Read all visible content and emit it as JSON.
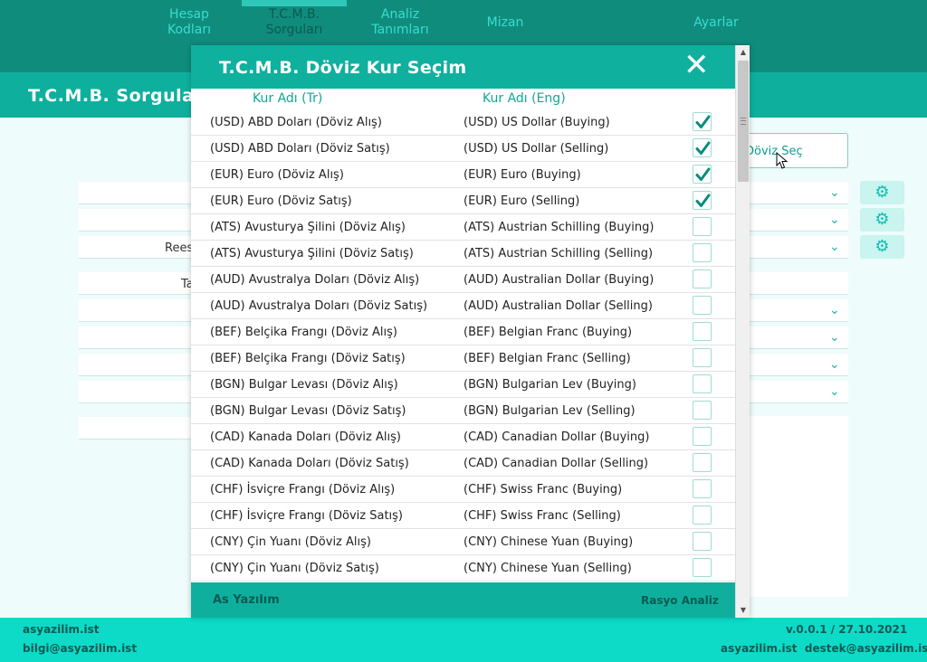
{
  "nav": {
    "items": [
      {
        "label_line1": "Hesap",
        "label_line2": "Kodları"
      },
      {
        "label_line1": "T.C.M.B.",
        "label_line2": "Sorguları"
      },
      {
        "label_line1": "Analiz",
        "label_line2": "Tanımları"
      },
      {
        "label_line1": "Mizan",
        "label_line2": ""
      },
      {
        "label_line1": "Ayarlar",
        "label_line2": ""
      }
    ]
  },
  "page": {
    "title": "T.C.M.B. Sorguları",
    "labels": {
      "rees": "Rees",
      "ta": "Ta"
    },
    "select_button_label": "Döviz Seç"
  },
  "modal": {
    "title": "T.C.M.B. Döviz Kur Seçim",
    "close_icon": "close-icon",
    "columns": {
      "tr": "Kur Adı (Tr)",
      "en": "Kur Adı (Eng)"
    },
    "rows": [
      {
        "tr": "(USD) ABD Doları (Döviz Alış)",
        "en": "(USD) US Dollar (Buying)",
        "checked": true
      },
      {
        "tr": "(USD) ABD Doları (Döviz Satış)",
        "en": "(USD) US Dollar (Selling)",
        "checked": true
      },
      {
        "tr": "(EUR) Euro (Döviz Alış)",
        "en": "(EUR) Euro (Buying)",
        "checked": true
      },
      {
        "tr": "(EUR) Euro (Döviz Satış)",
        "en": "(EUR) Euro (Selling)",
        "checked": true
      },
      {
        "tr": "(ATS) Avusturya Şilini (Döviz Alış)",
        "en": "(ATS) Austrian Schilling (Buying)",
        "checked": false
      },
      {
        "tr": "(ATS) Avusturya Şilini (Döviz Satış)",
        "en": "(ATS) Austrian Schilling (Selling)",
        "checked": false
      },
      {
        "tr": "(AUD) Avustralya Doları (Döviz Alış)",
        "en": "(AUD) Australian Dollar (Buying)",
        "checked": false
      },
      {
        "tr": "(AUD) Avustralya Doları (Döviz Satış)",
        "en": "(AUD) Australian Dollar (Selling)",
        "checked": false
      },
      {
        "tr": "(BEF) Belçika Frangı (Döviz Alış)",
        "en": "(BEF) Belgian Franc (Buying)",
        "checked": false
      },
      {
        "tr": "(BEF) Belçika Frangı (Döviz Satış)",
        "en": "(BEF) Belgian Franc (Selling)",
        "checked": false
      },
      {
        "tr": "(BGN) Bulgar Levası (Döviz Alış)",
        "en": "(BGN) Bulgarian Lev (Buying)",
        "checked": false
      },
      {
        "tr": "(BGN) Bulgar Levası (Döviz Satış)",
        "en": "(BGN) Bulgarian Lev (Selling)",
        "checked": false
      },
      {
        "tr": "(CAD) Kanada Doları (Döviz Alış)",
        "en": "(CAD) Canadian Dollar (Buying)",
        "checked": false
      },
      {
        "tr": "(CAD) Kanada Doları (Döviz Satış)",
        "en": "(CAD) Canadian Dollar (Selling)",
        "checked": false
      },
      {
        "tr": "(CHF) İsviçre Frangı (Döviz Alış)",
        "en": "(CHF) Swiss Franc (Buying)",
        "checked": false
      },
      {
        "tr": "(CHF) İsviçre Frangı (Döviz Satış)",
        "en": "(CHF) Swiss Franc (Selling)",
        "checked": false
      },
      {
        "tr": "(CNY) Çin Yuanı (Döviz Alış)",
        "en": "(CNY) Chinese Yuan (Buying)",
        "checked": false
      },
      {
        "tr": "(CNY) Çin Yuanı (Döviz Satış)",
        "en": "(CNY) Chinese Yuan (Selling)",
        "checked": false
      }
    ],
    "footer_left": "As Yazılım",
    "footer_right": "Rasyo Analiz"
  },
  "footer": {
    "site": "asyazilim.ist",
    "email": "bilgi@asyazilim.ist",
    "version": "v.0.0.1 / 27.10.2021",
    "support": "asyazilim.ist  destek@asyazilim.ist"
  },
  "colors": {
    "nav_bg": "#108c7d",
    "accent": "#0fb09e",
    "footer_bg": "#0ddbc8",
    "check": "#0b8c7c"
  }
}
